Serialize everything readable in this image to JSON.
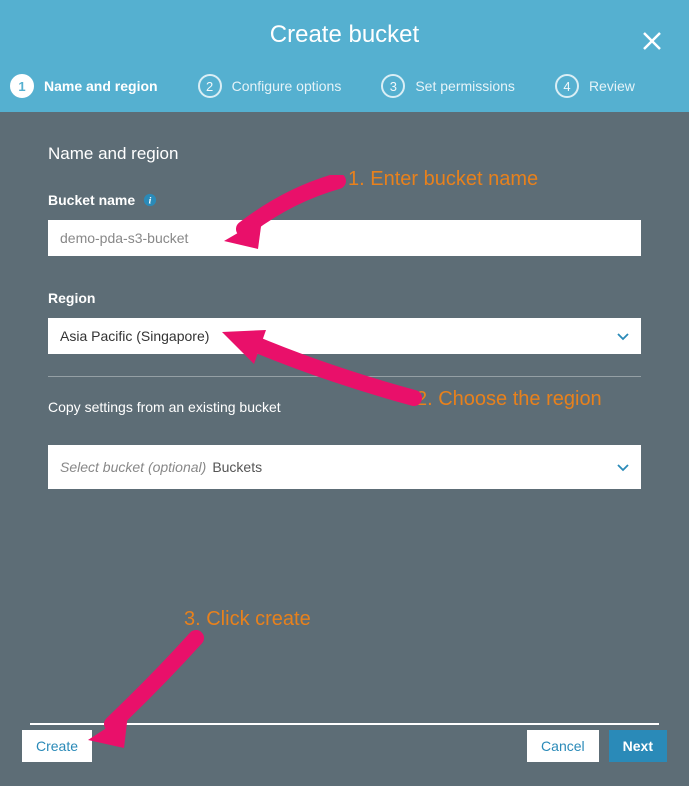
{
  "header": {
    "title": "Create bucket"
  },
  "wizard": {
    "steps": [
      {
        "num": "1",
        "label": "Name and region",
        "active": true
      },
      {
        "num": "2",
        "label": "Configure options",
        "active": false
      },
      {
        "num": "3",
        "label": "Set permissions",
        "active": false
      },
      {
        "num": "4",
        "label": "Review",
        "active": false
      }
    ]
  },
  "form": {
    "section_title": "Name and region",
    "bucket_name_label": "Bucket name",
    "bucket_name_value": "demo-pda-s3-bucket",
    "region_label": "Region",
    "region_value": "Asia Pacific (Singapore)",
    "copy_label": "Copy settings from an existing bucket",
    "copy_placeholder": "Select bucket (optional)",
    "copy_suffix": "Buckets"
  },
  "footer": {
    "create": "Create",
    "cancel": "Cancel",
    "next": "Next"
  },
  "annotations": {
    "a1": "1. Enter bucket name",
    "a2": "2. Choose the region",
    "a3": "3. Click create"
  }
}
